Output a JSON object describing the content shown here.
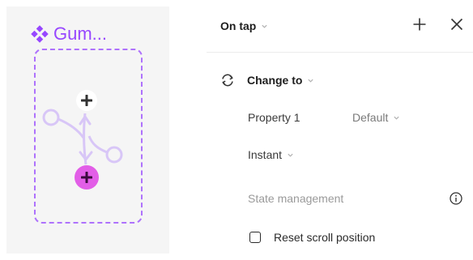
{
  "canvas": {
    "component_name": "Gum...",
    "component_icon": "component-icon",
    "hotspot_top_icon": "plus-icon",
    "hotspot_bottom_icon": "plus-icon",
    "colors": {
      "component": "#9747ff",
      "hotspot_active": "#e25ee7",
      "canvas_bg": "#f5f5f5"
    }
  },
  "panel": {
    "trigger": {
      "label": "On tap",
      "chevron_icon": "chevron-down-icon"
    },
    "header_actions": {
      "add_icon": "plus-icon",
      "close_icon": "close-icon"
    },
    "action": {
      "icon": "swap-arrows-icon",
      "label": "Change to",
      "chevron_icon": "chevron-down-icon"
    },
    "property": {
      "name": "Property 1",
      "value": "Default",
      "chevron_icon": "chevron-down-icon"
    },
    "animation": {
      "value": "Instant",
      "chevron_icon": "chevron-down-icon"
    },
    "state_management": {
      "label": "State management",
      "info_icon": "info-icon"
    },
    "reset_scroll": {
      "label": "Reset scroll position",
      "checked": false
    }
  }
}
